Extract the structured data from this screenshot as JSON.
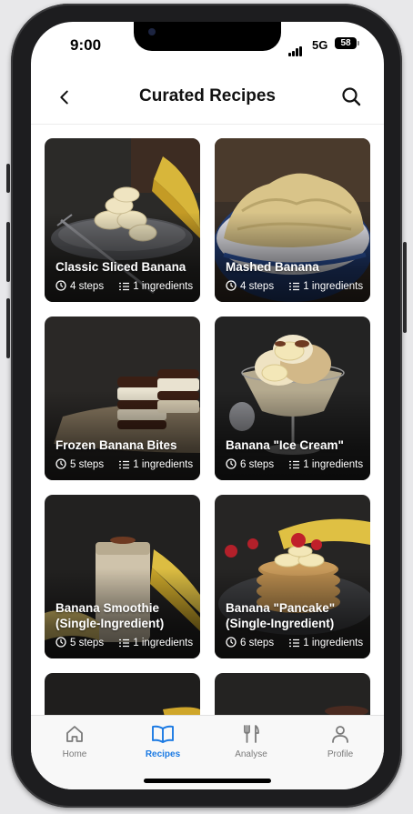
{
  "status_bar": {
    "time": "9:00",
    "network": "5G",
    "battery": "58"
  },
  "header": {
    "title": "Curated Recipes",
    "back_icon": "chevron-left-icon",
    "search_icon": "search-icon"
  },
  "recipes": [
    {
      "title": "Classic Sliced Banana",
      "steps": "4 steps",
      "ingredients": "1 ingredients"
    },
    {
      "title": "Mashed Banana",
      "steps": "4 steps",
      "ingredients": "1 ingredients"
    },
    {
      "title": "Frozen Banana Bites",
      "steps": "5 steps",
      "ingredients": "1 ingredients"
    },
    {
      "title": "Banana \"Ice Cream\"",
      "steps": "6 steps",
      "ingredients": "1 ingredients"
    },
    {
      "title": "Banana Smoothie (Single-Ingredient)",
      "steps": "5 steps",
      "ingredients": "1 ingredients"
    },
    {
      "title": "Banana \"Pancake\" (Single-Ingredient)",
      "steps": "6 steps",
      "ingredients": "1 ingredients"
    }
  ],
  "tab_bar": {
    "items": [
      {
        "label": "Home",
        "icon": "home-icon"
      },
      {
        "label": "Recipes",
        "icon": "book-icon",
        "active": true
      },
      {
        "label": "Analyse",
        "icon": "fork-knife-icon"
      },
      {
        "label": "Profile",
        "icon": "user-icon"
      }
    ]
  },
  "colors": {
    "accent": "#1b7ae3",
    "text": "#111111",
    "inactive": "#7a7a7a"
  }
}
